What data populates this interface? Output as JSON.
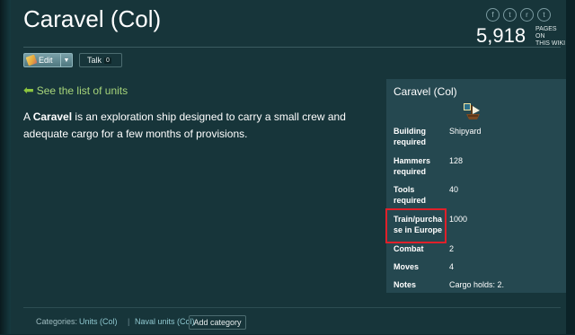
{
  "page": {
    "title": "Caravel (Col)"
  },
  "social": {
    "icons": [
      "facebook-icon",
      "twitter-icon",
      "reddit-icon",
      "tumblr-icon"
    ],
    "glyphs": [
      "f",
      "t",
      "r",
      "t"
    ]
  },
  "wiki_stats": {
    "count": "5,918",
    "label": "PAGES ON THIS WIKI"
  },
  "toolbar": {
    "edit_label": "Edit",
    "talk_label": "Talk",
    "talk_count": "0"
  },
  "nav": {
    "back_link": "See the list of units"
  },
  "article": {
    "intro_a": "A ",
    "bold_term": "Caravel",
    "intro_b": " is an exploration ship designed to carry a small crew and adequate cargo for a few months of provisions."
  },
  "infobox": {
    "title": "Caravel (Col)",
    "rows": [
      {
        "label": "Building required",
        "value": "Shipyard"
      },
      {
        "label": "Hammers required",
        "value": "128"
      },
      {
        "label": "Tools required",
        "value": "40"
      },
      {
        "label": "Train/purchase in Europe",
        "value": "1000"
      },
      {
        "label": "Combat",
        "value": "2"
      },
      {
        "label": "Moves",
        "value": "4"
      },
      {
        "label": "Notes",
        "value": "Cargo holds: 2."
      }
    ]
  },
  "categories": {
    "label": "Categories:",
    "items": [
      "Units (Col)",
      "Naval units (Col)"
    ],
    "add_label": "Add category"
  },
  "colors": {
    "link_green": "#a7d57a",
    "highlight_red": "#e0202a",
    "page_bg": "#17353a",
    "infobox_bg": "#254850"
  }
}
